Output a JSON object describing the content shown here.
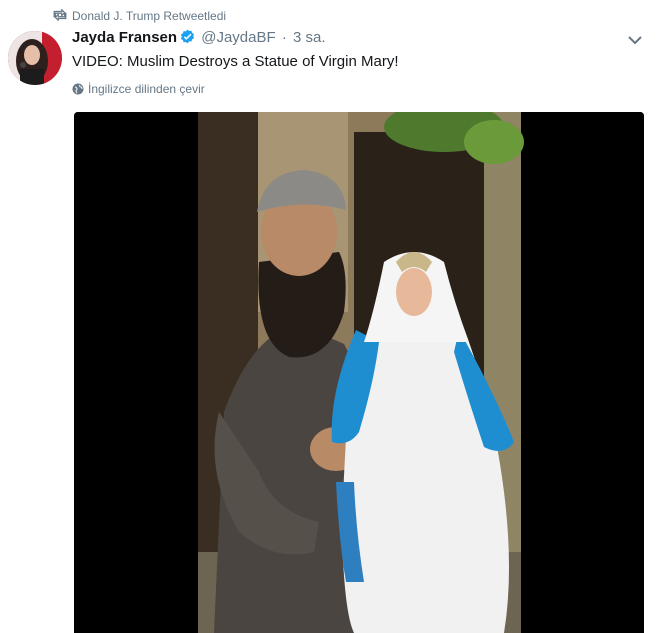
{
  "retweet": {
    "icon": "retweet-icon",
    "text": "Donald J. Trump Retweetledi"
  },
  "tweet": {
    "avatar_icon": "avatar",
    "display_name": "Jayda Fransen",
    "verified_icon": "verified-badge-icon",
    "handle": "@JaydaBF",
    "separator": "·",
    "time": "3 sa.",
    "text": "VIDEO: Muslim Destroys a Statue of Virgin Mary!",
    "translate_icon": "globe-icon",
    "translate_label": "İngilizce dilinden çevir",
    "menu_icon": "chevron-down-icon"
  },
  "colors": {
    "secondary_text": "#657786",
    "verified_blue": "#1da1f2",
    "primary_text": "#14171a"
  }
}
